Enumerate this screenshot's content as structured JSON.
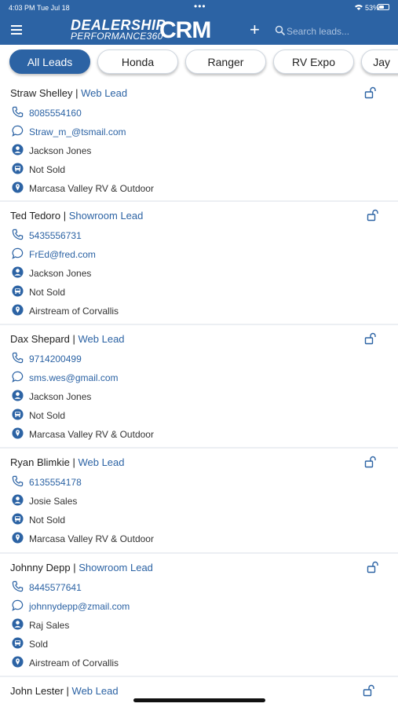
{
  "status_bar": {
    "time": "4:03 PM",
    "date": "Tue Jul 18",
    "dots": "•••",
    "battery": "53%"
  },
  "header": {
    "logo_line1": "DEALERSHIP",
    "logo_line2": "PERFORMANCE360",
    "logo_crm": "CRM",
    "add_label": "+",
    "search_placeholder": "Search leads...",
    "search_value": ""
  },
  "tabs": [
    "All Leads",
    "Honda",
    "Ranger",
    "RV Expo",
    "Jay"
  ],
  "leads": [
    {
      "name": "Straw Shelley",
      "type": "Web Lead",
      "phone": "8085554160",
      "email": "Straw_m_@tsmail.com",
      "salesperson": "Jackson Jones",
      "status": "Not Sold",
      "location": "Marcasa Valley RV & Outdoor"
    },
    {
      "name": "Ted Tedoro",
      "type": "Showroom Lead",
      "phone": "5435556731",
      "email": "FrEd@fred.com",
      "salesperson": "Jackson Jones",
      "status": "Not Sold",
      "location": "Airstream of Corvallis"
    },
    {
      "name": "Dax Shepard",
      "type": "Web Lead",
      "phone": "9714200499",
      "email": "sms.wes@gmail.com",
      "salesperson": "Jackson Jones",
      "status": "Not Sold",
      "location": "Marcasa Valley RV & Outdoor"
    },
    {
      "name": "Ryan Blimkie",
      "type": "Web Lead",
      "phone": "6135554178",
      "salesperson": "Josie Sales",
      "status": "Not Sold",
      "location": "Marcasa Valley RV & Outdoor"
    },
    {
      "name": "Johnny Depp",
      "type": "Showroom Lead",
      "phone": "8445577641",
      "email": "johnnydepp@zmail.com",
      "salesperson": "Raj Sales",
      "status": "Sold",
      "location": "Airstream of Corvallis"
    },
    {
      "name": "John Lester",
      "type": "Web Lead"
    }
  ],
  "colors": {
    "brand": "#2c63a4",
    "icon_blue": "#2c63a4",
    "divider": "#eceff3"
  },
  "icons": {
    "phone": "phone-icon",
    "email": "message-icon",
    "salesperson": "person-icon",
    "status": "vehicle-icon",
    "location": "location-icon",
    "lock": "unlock-icon",
    "menu": "hamburger-icon",
    "search": "search-icon"
  }
}
